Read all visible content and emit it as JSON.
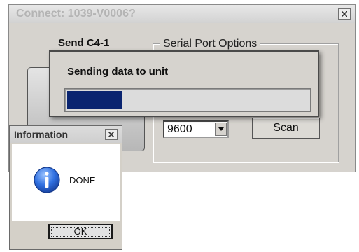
{
  "connect_dialog": {
    "title": "Connect: 1039-V0006?",
    "send_label": "Send C4-1",
    "serial_group_legend": "Serial Port Options",
    "baud_rate": "9600",
    "scan_label": "Scan",
    "close_icon": "close-icon"
  },
  "progress_dialog": {
    "label": "Sending data to unit",
    "progress_fraction": 0.23,
    "fill_color": "#0a2470"
  },
  "info_dialog": {
    "title": "Information",
    "message": "DONE",
    "ok_label": "OK",
    "icon": "info-icon",
    "close_icon": "close-icon"
  }
}
